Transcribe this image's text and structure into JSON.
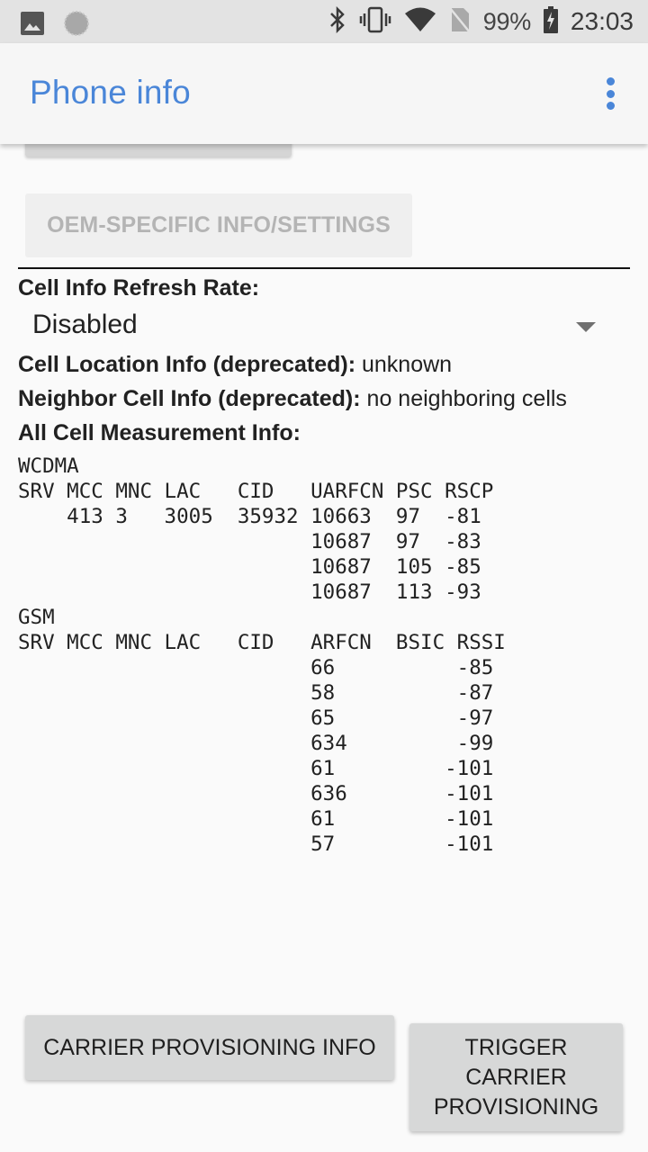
{
  "status_bar": {
    "left_icons": [
      "image-notification-icon",
      "sync-progress-icon"
    ],
    "right_icons": [
      "bluetooth-icon",
      "vibrate-icon",
      "wifi-icon",
      "no-sim-icon"
    ],
    "battery_percent": "99%",
    "battery_icon": "battery-charging-icon",
    "time": "23:03"
  },
  "app_bar": {
    "title": "Phone info",
    "overflow_icon": "more-vert-icon",
    "accent_color": "#4a86d8"
  },
  "buttons": {
    "oem_settings": "OEM-SPECIFIC INFO/SETTINGS",
    "carrier_provisioning_info": "CARRIER PROVISIONING INFO",
    "trigger_carrier_provisioning": "TRIGGER CARRIER PROVISIONING"
  },
  "refresh_rate": {
    "label": "Cell Info Refresh Rate:",
    "selected": "Disabled"
  },
  "cell_location": {
    "label": "Cell Location Info (deprecated):",
    "value": "unknown"
  },
  "neighbor_cell": {
    "label": "Neighbor Cell Info (deprecated):",
    "value": "no neighboring cells"
  },
  "all_cell": {
    "label": "All Cell Measurement Info:"
  },
  "wcdma": {
    "title": "WCDMA",
    "headers": [
      "SRV",
      "MCC",
      "MNC",
      "LAC",
      "CID",
      "UARFCN",
      "PSC",
      "RSCP"
    ],
    "rows": [
      {
        "srv": "",
        "mcc": "413",
        "mnc": "3",
        "lac": "3005",
        "cid": "35932",
        "uarfcn": "10663",
        "psc": "97",
        "rscp": "-81"
      },
      {
        "srv": "",
        "mcc": "",
        "mnc": "",
        "lac": "",
        "cid": "",
        "uarfcn": "10687",
        "psc": "97",
        "rscp": "-83"
      },
      {
        "srv": "",
        "mcc": "",
        "mnc": "",
        "lac": "",
        "cid": "",
        "uarfcn": "10687",
        "psc": "105",
        "rscp": "-85"
      },
      {
        "srv": "",
        "mcc": "",
        "mnc": "",
        "lac": "",
        "cid": "",
        "uarfcn": "10687",
        "psc": "113",
        "rscp": "-93"
      }
    ]
  },
  "gsm": {
    "title": "GSM",
    "headers": [
      "SRV",
      "MCC",
      "MNC",
      "LAC",
      "CID",
      "ARFCN",
      "BSIC",
      "RSSI"
    ],
    "rows": [
      {
        "arfcn": "66",
        "bsic": "",
        "rssi": "-85"
      },
      {
        "arfcn": "58",
        "bsic": "",
        "rssi": "-87"
      },
      {
        "arfcn": "65",
        "bsic": "",
        "rssi": "-97"
      },
      {
        "arfcn": "634",
        "bsic": "",
        "rssi": "-99"
      },
      {
        "arfcn": "61",
        "bsic": "",
        "rssi": "-101"
      },
      {
        "arfcn": "636",
        "bsic": "",
        "rssi": "-101"
      },
      {
        "arfcn": "61",
        "bsic": "",
        "rssi": "-101"
      },
      {
        "arfcn": "57",
        "bsic": "",
        "rssi": "-101"
      }
    ]
  }
}
